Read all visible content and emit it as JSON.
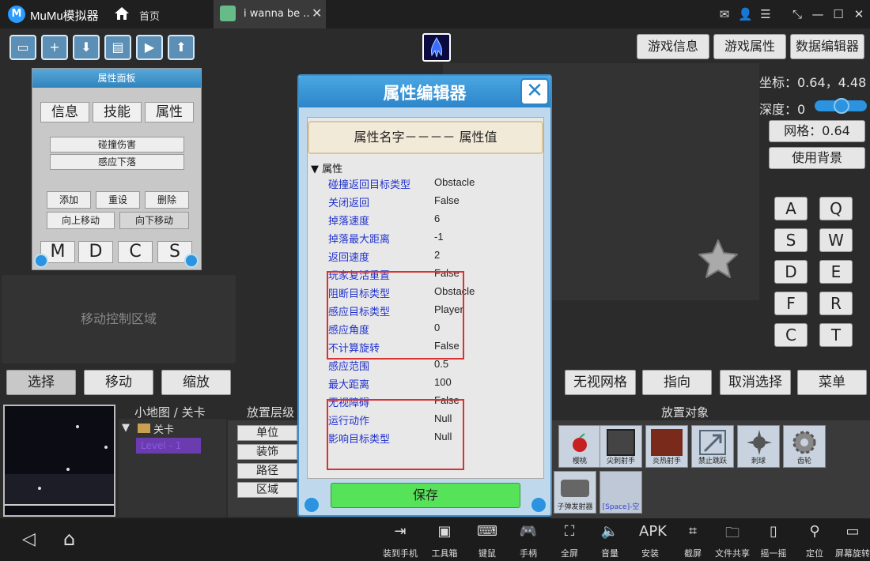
{
  "titlebar": {
    "app_title": "MuMu模拟器",
    "logo_glyph": "M",
    "home_tab": "首页",
    "game_tab": "i wanna be ..",
    "close_glyph": "✕",
    "icons": [
      "mail-icon",
      "user-icon",
      "menu-icon",
      "shrink-icon",
      "minimize-icon",
      "maximize-icon",
      "close-window-icon"
    ],
    "icon_glyphs": [
      "✉",
      "👤",
      "☰",
      "⤡",
      "—",
      "☐",
      "✕"
    ]
  },
  "toolbar": {
    "icon_names": [
      "open-folder-icon",
      "new-file-icon",
      "download-icon",
      "save-disk-icon",
      "play-icon",
      "upload-icon"
    ],
    "icon_glyphs": [
      "▭",
      "+",
      "⬇",
      "▤",
      "▶",
      "⬆"
    ]
  },
  "top_buttons": {
    "game_info": "游戏信息",
    "game_props": "游戏属性",
    "data_editor": "数据编辑器"
  },
  "info": {
    "coords_label": "坐标：0.64，4.48",
    "depth_label": "深度：0",
    "grid_btn": "网格：0.64",
    "bg_btn": "使用背景"
  },
  "attr_panel": {
    "title": "属性面板",
    "tabs": [
      "信息",
      "技能",
      "属性"
    ],
    "list": [
      "碰撞伤害",
      "感应下落"
    ],
    "add": "添加",
    "reset": "重设",
    "delete": "删除",
    "move_up": "向上移动",
    "move_down": "向下移动",
    "keys": [
      "M",
      "D",
      "C",
      "S"
    ]
  },
  "move_area": "移动控制区域",
  "modes": {
    "select": "选择",
    "move": "移动",
    "scale": "缩放",
    "ignore_grid": "无视网格",
    "point": "指向",
    "deselect": "取消选择",
    "menu": "菜单"
  },
  "keypad": [
    "A",
    "Q",
    "S",
    "W",
    "D",
    "E",
    "F",
    "R",
    "C",
    "T"
  ],
  "bottom": {
    "minimap_label": "小地图 / 关卡",
    "level_folder": "关卡",
    "level_item": "Level - 1",
    "layer_label": "放置层级",
    "layers": [
      "单位",
      "装饰",
      "路径",
      "区域"
    ],
    "objects_label": "放置对象",
    "objects": [
      "樱桃",
      "尖刺射手",
      "炎热射手",
      "禁止跳跃",
      "刺球",
      "齿轮",
      "子弹发射器",
      "[Space]-空"
    ]
  },
  "dialog": {
    "title": "属性编辑器",
    "close_glyph": "✕",
    "caption": "属性名字－－－－ 属性值",
    "tree_root": "▼ 属性",
    "props": [
      {
        "name": "碰撞返回目标类型",
        "value": "Obstacle"
      },
      {
        "name": "关闭返回",
        "value": "False"
      },
      {
        "name": "掉落速度",
        "value": "6"
      },
      {
        "name": "掉落最大距离",
        "value": "-1"
      },
      {
        "name": "返回速度",
        "value": "2"
      },
      {
        "name": "玩家复活重置",
        "value": "False"
      },
      {
        "name": "阻断目标类型",
        "value": "Obstacle"
      },
      {
        "name": "感应目标类型",
        "value": "Player"
      },
      {
        "name": "感应角度",
        "value": "0"
      },
      {
        "name": "不计算旋转",
        "value": "False"
      },
      {
        "name": "感应范围",
        "value": "0.5"
      },
      {
        "name": "最大距离",
        "value": "100"
      },
      {
        "name": "无视障碍",
        "value": "False"
      },
      {
        "name": "运行动作",
        "value": "Null"
      },
      {
        "name": "影响目标类型",
        "value": "Null"
      }
    ],
    "save": "保存"
  },
  "taskbar": {
    "items": [
      "装到手机",
      "工具箱",
      "键鼠",
      "手柄",
      "全屏",
      "音量",
      "安装",
      "截屏",
      "文件共享",
      "摇一摇",
      "定位",
      "屏幕旋转"
    ],
    "glyphs": [
      "⇥",
      "▣",
      "⌨",
      "🎮",
      "⛶",
      "🔈",
      "APK",
      "⌗",
      "🗀",
      "▯",
      "⚲",
      "▭"
    ],
    "back_glyph": "◁",
    "home_glyph": "⌂"
  },
  "colors": {
    "accent": "#2c85c9",
    "highlight_box": "#d83232",
    "save_green": "#56e35a"
  }
}
